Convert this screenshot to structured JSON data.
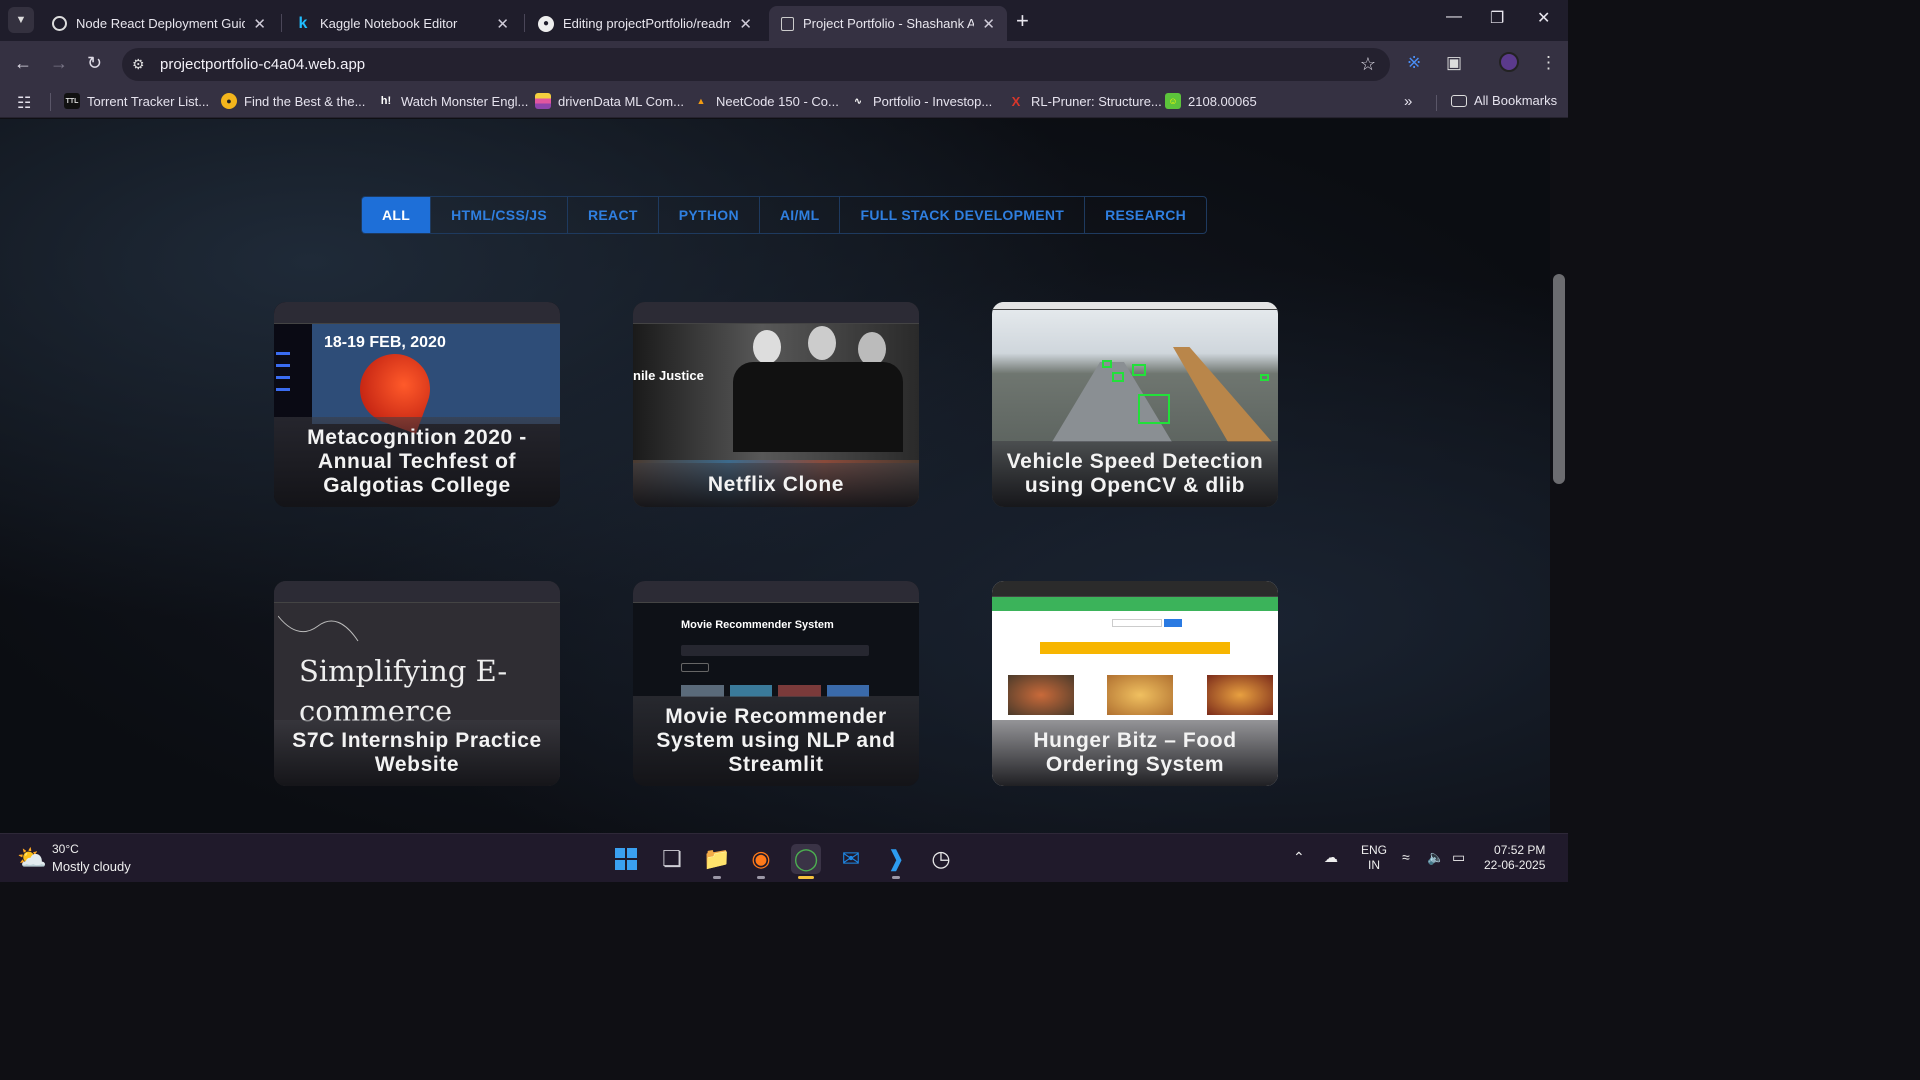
{
  "browser": {
    "tabs": [
      {
        "title": "Node React Deployment Guide",
        "icon": "chatgpt-icon"
      },
      {
        "title": "Kaggle Notebook Editor",
        "icon": "kaggle-icon"
      },
      {
        "title": "Editing projectPortfolio/readme",
        "icon": "github-icon"
      },
      {
        "title": "Project Portfolio - Shashank Ag",
        "icon": "portfolio-icon",
        "active": true
      }
    ],
    "url": "projectportfolio-c4a04.web.app",
    "bookmarks": [
      {
        "label": "Torrent Tracker List..."
      },
      {
        "label": "Find the Best & the..."
      },
      {
        "label": "Watch Monster Engl..."
      },
      {
        "label": "drivenData ML Com..."
      },
      {
        "label": "NeetCode 150 - Co..."
      },
      {
        "label": "Portfolio - Investop..."
      },
      {
        "label": "RL-Pruner: Structure..."
      },
      {
        "label": "2108.00065"
      }
    ],
    "all_bookmarks": "All Bookmarks"
  },
  "filters": [
    "ALL",
    "HTML/CSS/JS",
    "REACT",
    "PYTHON",
    "AI/ML",
    "FULL STACK DEVELOPMENT",
    "RESEARCH"
  ],
  "projects": [
    {
      "title": "Metacognition 2020 - Annual Techfest of Galgotias College",
      "thumb_text": "18-19 FEB, 2020"
    },
    {
      "title": "Netflix Clone",
      "thumb_text": "nile Justice"
    },
    {
      "title": "Vehicle Speed Detection using OpenCV & dlib"
    },
    {
      "title": "S7C Internship Practice Website",
      "thumb_text": "Simplifying E-commerce"
    },
    {
      "title": "Movie Recommender System using NLP and Streamlit",
      "thumb_text": "Movie Recommender System"
    },
    {
      "title": "Hunger Bitz – Food Ordering System"
    }
  ],
  "taskbar": {
    "temperature": "30°C",
    "weather": "Mostly cloudy",
    "lang1": "ENG",
    "lang2": "IN",
    "time": "07:52 PM",
    "date": "22-06-2025"
  },
  "colors": {
    "accent": "#1e6fd8",
    "filter_text": "#2f7fe0"
  }
}
